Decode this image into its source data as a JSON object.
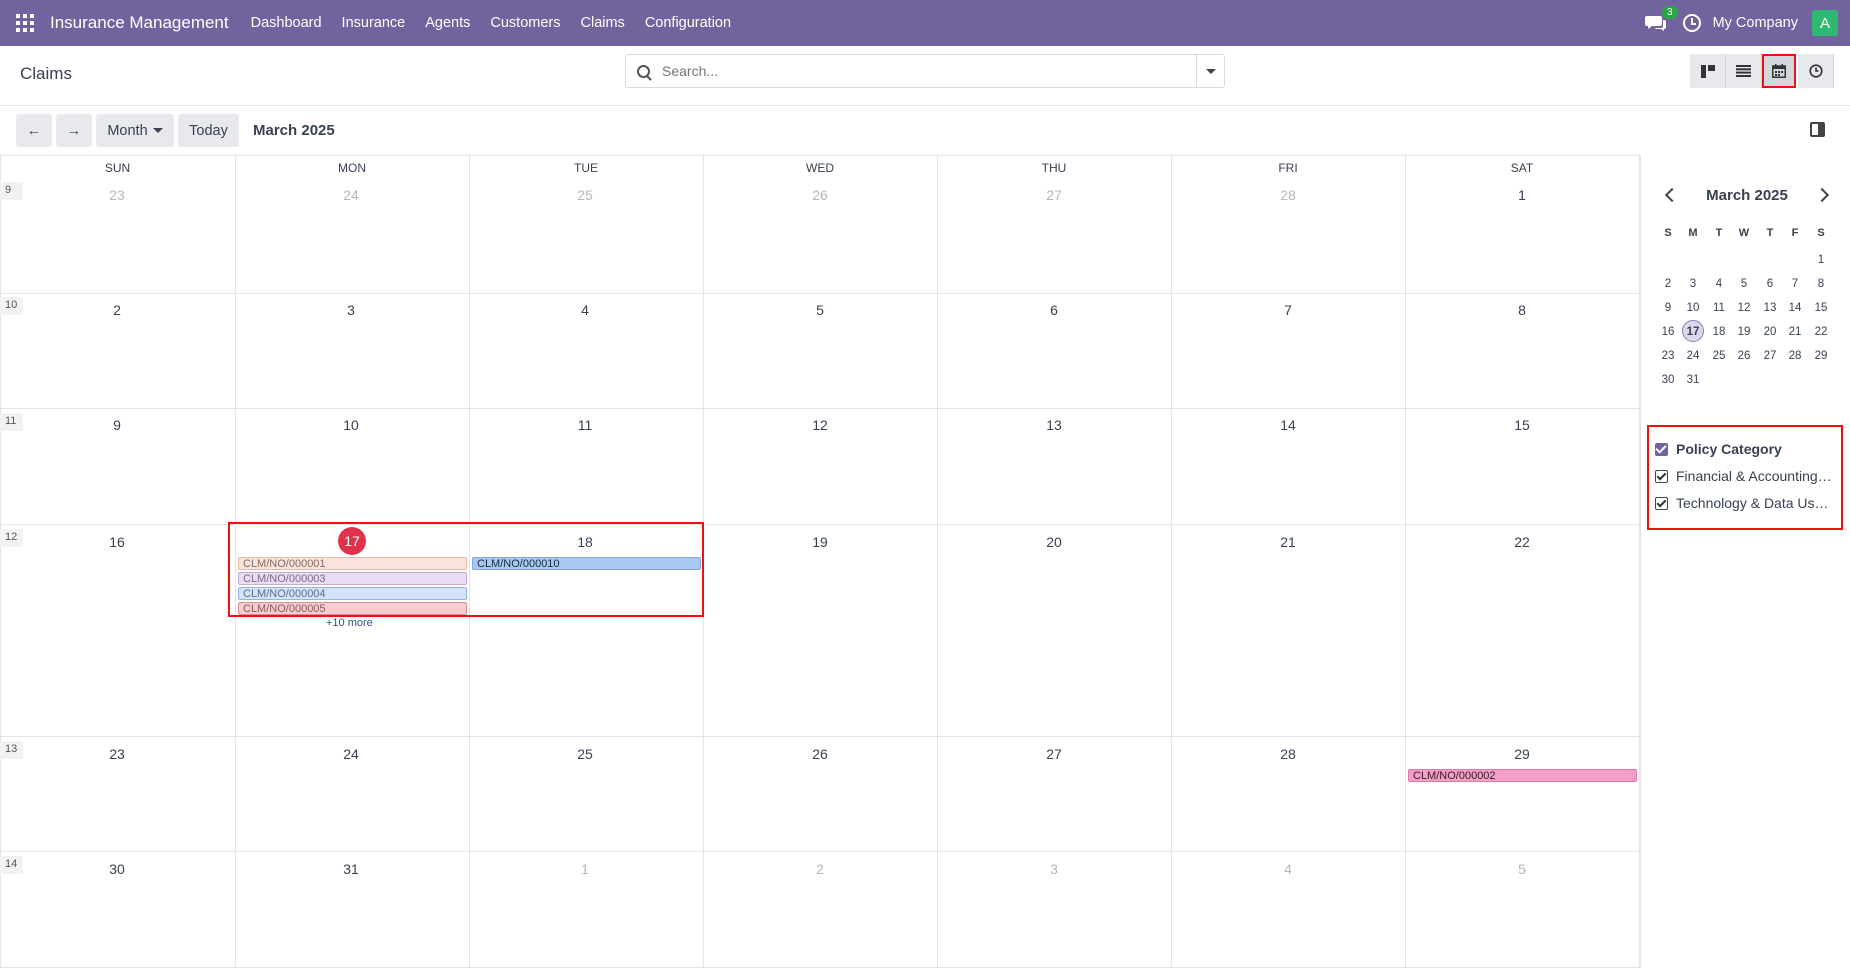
{
  "navbar": {
    "app_name": "Insurance Management",
    "menu": [
      "Dashboard",
      "Insurance",
      "Agents",
      "Customers",
      "Claims",
      "Configuration"
    ],
    "chat_badge": "3",
    "company": "My Company",
    "avatar_initial": "A"
  },
  "control": {
    "title": "Claims",
    "search_placeholder": "Search..."
  },
  "toolbar": {
    "prev_icon": "←",
    "next_icon": "→",
    "scale_label": "Month",
    "today_label": "Today",
    "range_label": "March 2025"
  },
  "calendar": {
    "weekdays": [
      "SUN",
      "MON",
      "TUE",
      "WED",
      "THU",
      "FRI",
      "SAT"
    ],
    "weeks": [
      {
        "num": "9",
        "days": [
          "23",
          "24",
          "25",
          "26",
          "27",
          "28",
          "1"
        ]
      },
      {
        "num": "10",
        "days": [
          "2",
          "3",
          "4",
          "5",
          "6",
          "7",
          "8"
        ]
      },
      {
        "num": "11",
        "days": [
          "9",
          "10",
          "11",
          "12",
          "13",
          "14",
          "15"
        ]
      },
      {
        "num": "12",
        "days": [
          "16",
          "17",
          "18",
          "19",
          "20",
          "21",
          "22"
        ]
      },
      {
        "num": "13",
        "days": [
          "23",
          "24",
          "25",
          "26",
          "27",
          "28",
          "29"
        ]
      },
      {
        "num": "14",
        "days": [
          "30",
          "31",
          "1",
          "2",
          "3",
          "4",
          "5"
        ]
      }
    ],
    "events": {
      "mon17": [
        "CLM/NO/000001",
        "CLM/NO/000003",
        "CLM/NO/000004",
        "CLM/NO/000005"
      ],
      "mon17_more": "+10 more",
      "tue18": "CLM/NO/000010",
      "sat29": "CLM/NO/000002"
    },
    "colors": {
      "today": "#e0324b",
      "ev1": "#f9e4dd",
      "ev3": "#eadcf3",
      "ev4": "#d4e3fb",
      "ev5": "#f3cdd0",
      "ev10": "#a8c8f0",
      "ev2": "#f39ec4"
    }
  },
  "sidepanel": {
    "mini_title": "March 2025",
    "mini_dow": [
      "S",
      "M",
      "T",
      "W",
      "T",
      "F",
      "S"
    ],
    "mini_weeks": [
      [
        "",
        "",
        "",
        "",
        "",
        "",
        "1"
      ],
      [
        "2",
        "3",
        "4",
        "5",
        "6",
        "7",
        "8"
      ],
      [
        "9",
        "10",
        "11",
        "12",
        "13",
        "14",
        "15"
      ],
      [
        "16",
        "17",
        "18",
        "19",
        "20",
        "21",
        "22"
      ],
      [
        "23",
        "24",
        "25",
        "26",
        "27",
        "28",
        "29"
      ],
      [
        "30",
        "31",
        "",
        "",
        "",
        "",
        ""
      ]
    ],
    "filter_title": "Policy Category",
    "filters": [
      "Financial & Accounting…",
      "Technology & Data Us…"
    ]
  }
}
